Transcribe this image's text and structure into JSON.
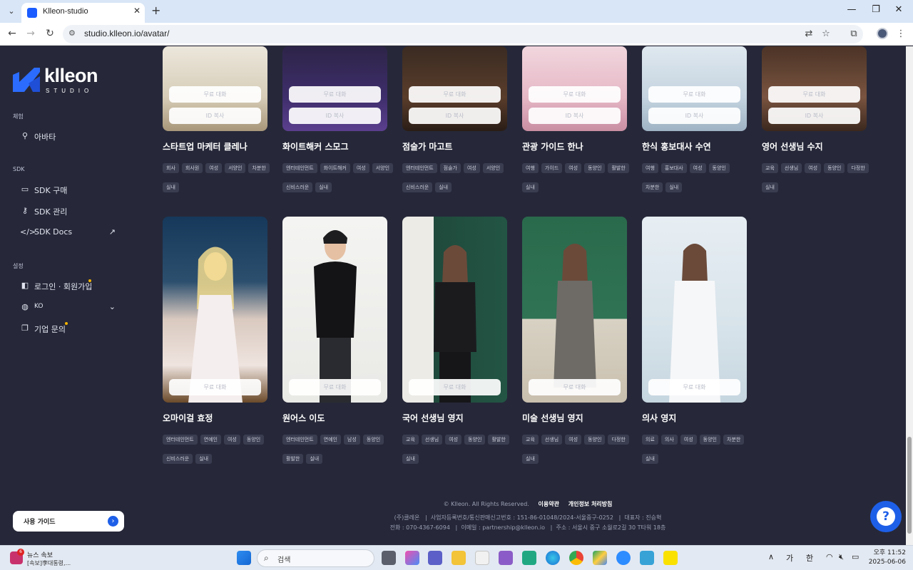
{
  "browser": {
    "tab_title": "Klleon-studio",
    "url": "studio.klleon.io/avatar/"
  },
  "sidebar": {
    "logo_word": "klleon",
    "logo_sub": "STUDIO",
    "sections": [
      {
        "title": "체험",
        "items": [
          {
            "label": "아바타",
            "icon": "avatar-icon"
          }
        ]
      },
      {
        "title": "SDK",
        "items": [
          {
            "label": "SDK 구매",
            "icon": "card-icon"
          },
          {
            "label": "SDK 관리",
            "icon": "key-icon"
          },
          {
            "label": "SDK Docs",
            "icon": "code-icon"
          }
        ]
      },
      {
        "title": "설정",
        "items": [
          {
            "label": "로그인 · 회원가입",
            "icon": "login-icon"
          },
          {
            "label": "KO",
            "icon": "globe-icon"
          },
          {
            "label": "기업 문의",
            "icon": "document-icon"
          }
        ]
      }
    ],
    "guide_button": "사용 가이드"
  },
  "cards": {
    "free_chat_label": "무료 대화",
    "id_copy_label": "ID 복사",
    "row1": [
      {
        "name": "스타트업 마케터 클레나",
        "tags": [
          "회사",
          "회사원",
          "여성",
          "서양인",
          "차분한",
          "실내"
        ]
      },
      {
        "name": "화이트해커 스모그",
        "tags": [
          "엔터테인먼트",
          "화이트해커",
          "여성",
          "서양인",
          "신비스러운",
          "실내"
        ]
      },
      {
        "name": "점술가 마고트",
        "tags": [
          "엔터테인먼트",
          "점술가",
          "여성",
          "서양인",
          "신비스러운",
          "실내"
        ]
      },
      {
        "name": "관광 가이드 한나",
        "tags": [
          "여행",
          "가이드",
          "여성",
          "동양인",
          "활발한",
          "실내"
        ]
      },
      {
        "name": "한식 홍보대사 수연",
        "tags": [
          "여행",
          "홍보대사",
          "여성",
          "동양인",
          "차분한",
          "실내"
        ]
      },
      {
        "name": "영어 선생님 수지",
        "tags": [
          "교육",
          "선생님",
          "여성",
          "동양인",
          "다정한",
          "실내"
        ]
      }
    ],
    "row2": [
      {
        "name": "오마이걸 효정",
        "tags": [
          "엔터테인먼트",
          "연예인",
          "여성",
          "동양인",
          "신비스러운",
          "실내"
        ]
      },
      {
        "name": "원어스 이도",
        "tags": [
          "엔터테인먼트",
          "연예인",
          "남성",
          "동양인",
          "활발한",
          "실내"
        ]
      },
      {
        "name": "국어 선생님 영지",
        "tags": [
          "교육",
          "선생님",
          "여성",
          "동양인",
          "활발한",
          "실내"
        ]
      },
      {
        "name": "미술 선생님 영지",
        "tags": [
          "교육",
          "선생님",
          "여성",
          "동양인",
          "다정한",
          "실내"
        ]
      },
      {
        "name": "의사 영지",
        "tags": [
          "의료",
          "의사",
          "여성",
          "동양인",
          "차분한",
          "실내"
        ]
      }
    ]
  },
  "footer": {
    "copyright": "© Klleon. All Rights Reserved.",
    "terms": "이용약관",
    "privacy": "개인정보 처리방침",
    "company": "(주)클레온",
    "biz_no": "사업자등록번호/통신판매신고번호 : 151-86-01048/2024-서울중구-0252",
    "ceo": "대표자 : 진승혁",
    "phone": "전화 : 070-4367-6094",
    "email": "이메일 : partnership@klleon.io",
    "address": "주소 : 서울시 중구 소월로2길 30 T타워 18층"
  },
  "taskbar": {
    "news_title": "뉴스 속보",
    "news_sub": "[속보]李대통령,...",
    "news_badge": "6",
    "search_label": "검색",
    "ime1": "가",
    "ime2": "한",
    "time": "오후 11:52",
    "date": "2025-06-06"
  }
}
